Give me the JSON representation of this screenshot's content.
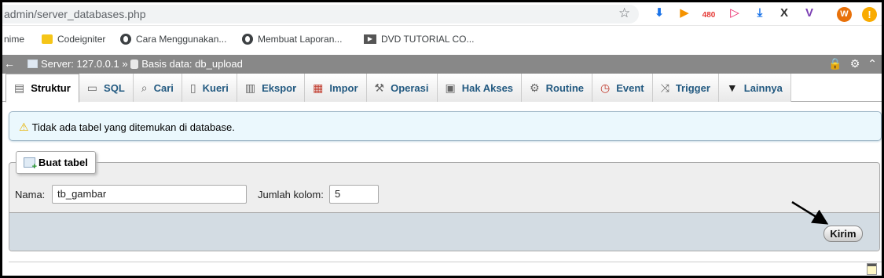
{
  "browser": {
    "url": "admin/server_databases.php",
    "extensions": {
      "download_count": "480",
      "avatar_letter": "W"
    }
  },
  "bookmarks": [
    {
      "label": "nime"
    },
    {
      "label": "Codeigniter"
    },
    {
      "label": "Cara Menggunakan..."
    },
    {
      "label": "Membuat Laporan..."
    },
    {
      "label": "DVD TUTORIAL CO..."
    }
  ],
  "breadcrumb": {
    "server": "Server: 127.0.0.1",
    "separator": "»",
    "database": "Basis data: db_upload"
  },
  "tabs": [
    {
      "label": "Struktur",
      "icon": "structure-icon",
      "active": true
    },
    {
      "label": "SQL",
      "icon": "sql-icon"
    },
    {
      "label": "Cari",
      "icon": "search-icon"
    },
    {
      "label": "Kueri",
      "icon": "query-icon"
    },
    {
      "label": "Ekspor",
      "icon": "export-icon"
    },
    {
      "label": "Impor",
      "icon": "import-icon"
    },
    {
      "label": "Operasi",
      "icon": "wrench-icon"
    },
    {
      "label": "Hak Akses",
      "icon": "privileges-icon"
    },
    {
      "label": "Routine",
      "icon": "routine-icon"
    },
    {
      "label": "Event",
      "icon": "clock-icon"
    },
    {
      "label": "Trigger",
      "icon": "trigger-icon"
    },
    {
      "label": "Lainnya",
      "icon": "dropdown-icon"
    }
  ],
  "notice": {
    "text": "Tidak ada tabel yang ditemukan di database."
  },
  "create_table": {
    "legend": "Buat tabel",
    "name_label": "Nama:",
    "name_value": "tb_gambar",
    "columns_label": "Jumlah kolom:",
    "columns_value": "5",
    "submit_label": "Kirim"
  }
}
